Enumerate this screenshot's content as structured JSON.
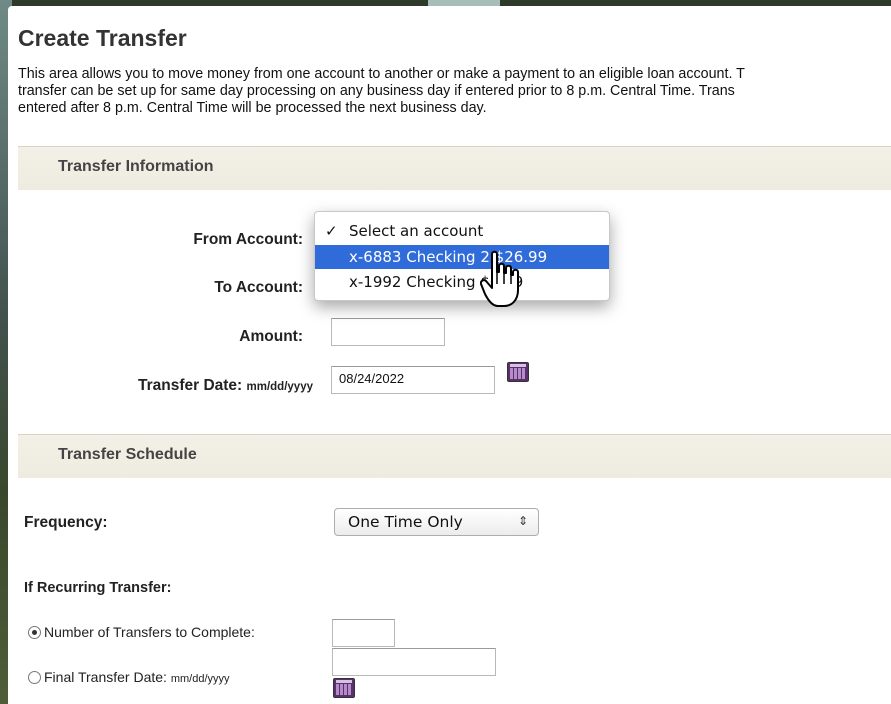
{
  "page": {
    "title": "Create Transfer",
    "intro_lines": [
      "This area allows you to move money from one account to another or make a payment to an eligible loan account. T",
      "transfer can be set up for same day processing on any business day if entered prior to 8 p.m. Central Time. Trans",
      "entered after 8 p.m. Central Time will be processed the next business day."
    ]
  },
  "transfer_info": {
    "section_title": "Transfer Information",
    "from_label": "From Account:",
    "to_label": "To Account:",
    "amount_label": "Amount:",
    "amount_value": "",
    "date_label": "Transfer Date:",
    "date_format": "mm/dd/yyyy",
    "date_value": "08/24/2022",
    "calendar_icon": "calendar-icon"
  },
  "account_dropdown": {
    "options": [
      {
        "label": "Select an account",
        "checked": true
      },
      {
        "label": "x-6883 Checking 2 $26.99",
        "highlighted": true
      },
      {
        "label": "x-1992 Checking $0.39"
      }
    ],
    "highlight_color": "#2f6bd9"
  },
  "schedule": {
    "section_title": "Transfer Schedule",
    "frequency_label": "Frequency:",
    "frequency_value": "One Time Only",
    "recurring_label": "If Recurring Transfer:",
    "num_transfers_label": "Number of Transfers to Complete:",
    "num_transfers_value": "",
    "final_date_label": "Final Transfer Date:",
    "final_date_format": "mm/dd/yyyy",
    "final_date_value": "",
    "selected_option": "number_of_transfers"
  }
}
